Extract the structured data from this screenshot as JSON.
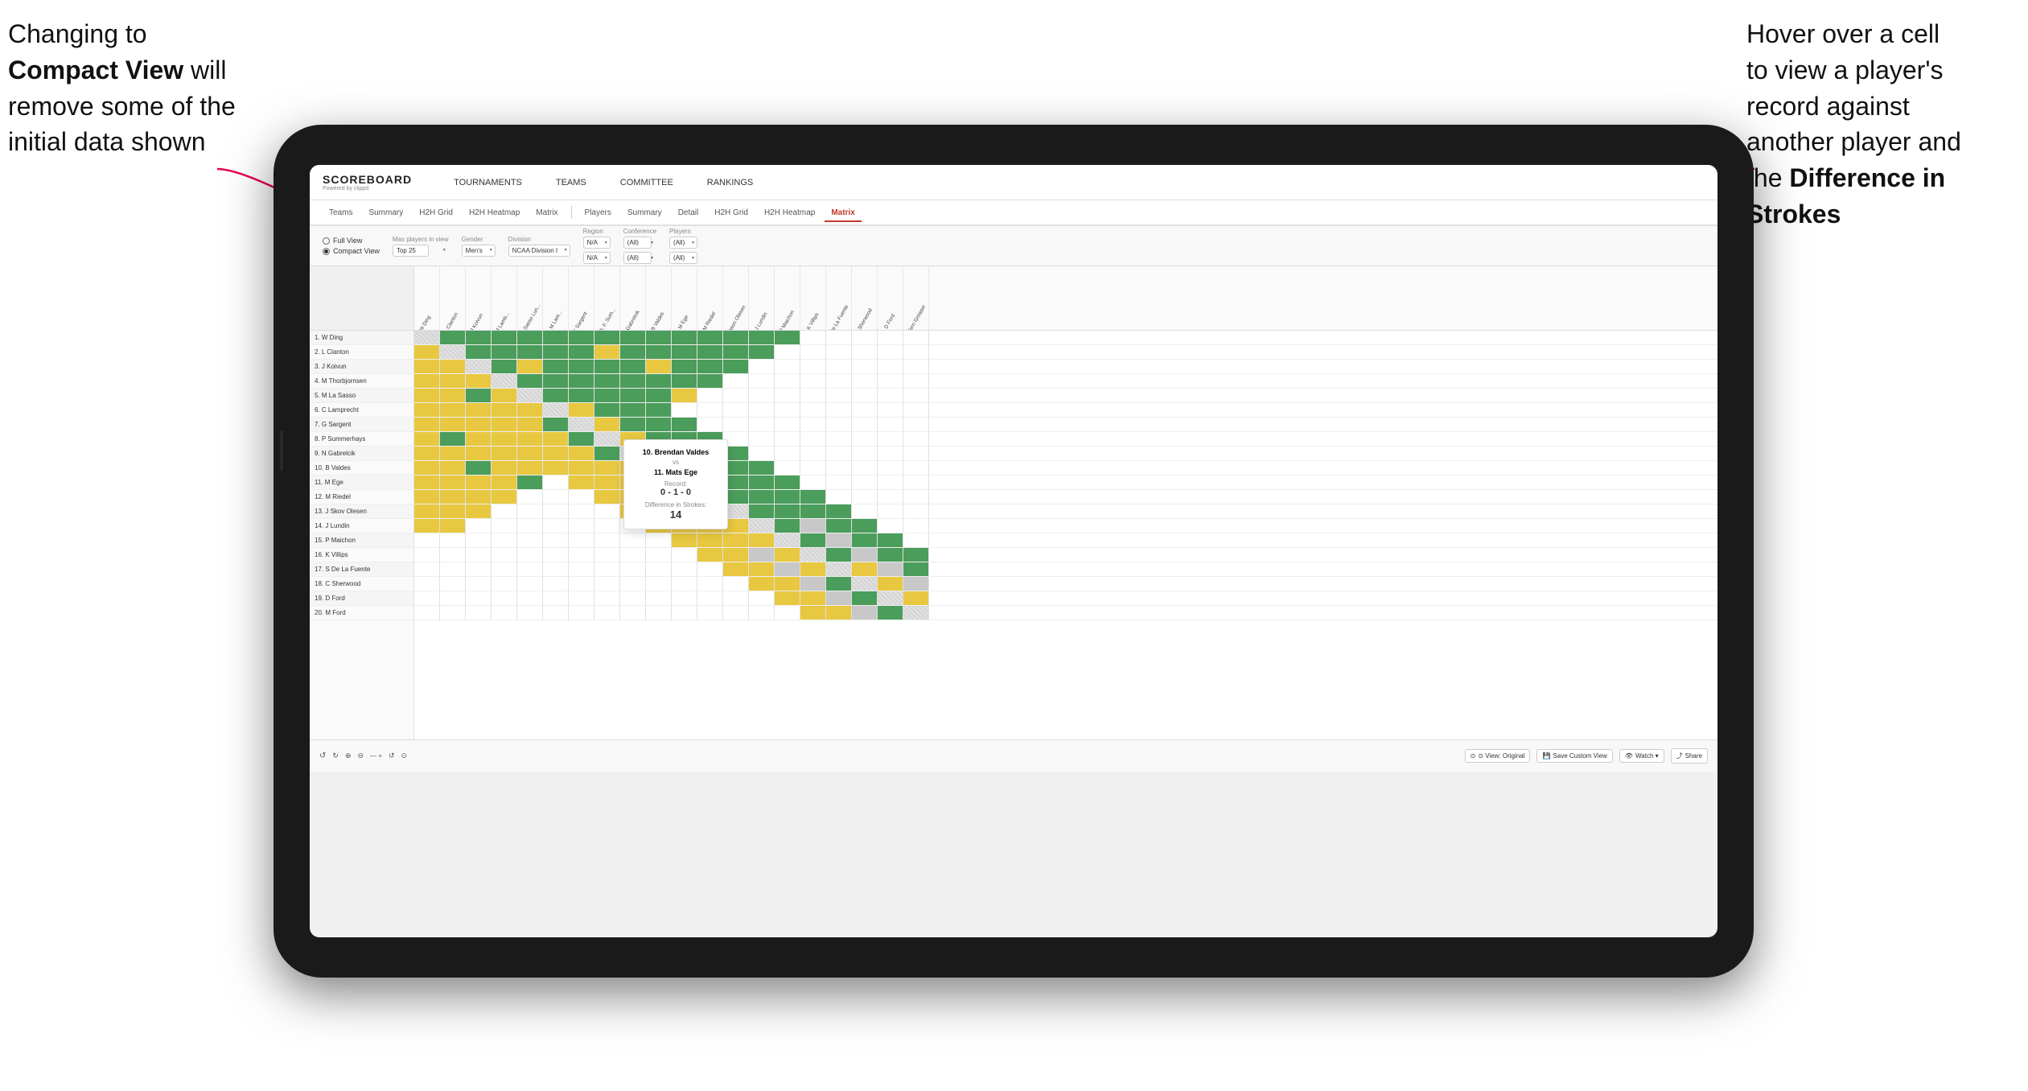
{
  "annotations": {
    "left": {
      "line1": "Changing to",
      "line2": "Compact View will",
      "line3": "remove some of the",
      "line4": "initial data shown"
    },
    "right": {
      "line1": "Hover over a cell",
      "line2": "to view a player's",
      "line3": "record against",
      "line4": "another player and",
      "line5": "the ",
      "bold5": "Difference in",
      "line6": "Strokes"
    }
  },
  "app": {
    "logo": "SCOREBOARD",
    "logo_sub": "Powered by clippd",
    "nav_items": [
      "TOURNAMENTS",
      "TEAMS",
      "COMMITTEE",
      "RANKINGS"
    ],
    "sub_nav_items": [
      "Teams",
      "Summary",
      "H2H Grid",
      "H2H Heatmap",
      "Matrix"
    ],
    "sub_nav_items2": [
      "Players",
      "Summary",
      "Detail",
      "H2H Grid",
      "H2H Heatmap",
      "Matrix"
    ],
    "active_sub": "Matrix"
  },
  "filters": {
    "view_options": [
      "Full View",
      "Compact View"
    ],
    "selected_view": "Compact View",
    "max_players_label": "Max players in view",
    "max_players_value": "Top 25",
    "gender_label": "Gender",
    "gender_value": "Men's",
    "division_label": "Division",
    "division_value": "NCAA Division I",
    "region_label": "Region",
    "region_value": "N/A",
    "conference_label": "Conference",
    "conference_value": "(All)",
    "players_label": "Players",
    "players_value": "(All)"
  },
  "players": [
    "1. W Ding",
    "2. L Clanton",
    "3. J Koivun",
    "4. M Thorbjornsen",
    "5. M La Sasso",
    "6. C Lamprecht",
    "7. G Sargent",
    "8. P Summerhays",
    "9. N Gabrelcik",
    "10. B Valdes",
    "11. M Ege",
    "12. M Riedel",
    "13. J Skov Olesen",
    "14. J Lundin",
    "15. P Maichon",
    "16. K Villips",
    "17. S De La Fuente",
    "18. C Sherwood",
    "19. D Ford",
    "20. M Ford"
  ],
  "col_headers": [
    "1. W Ding",
    "2. L Clanton",
    "3. J Koivun",
    "4. M Lamb...",
    "5. M La Sasso Lun...",
    "6. C. M",
    "7. G Sargent",
    "8. P. B. F.",
    "9. N Gabrelcik",
    "10. B Valdes",
    "11. M Ege",
    "12. M Riedel",
    "13. J Jason Olesen",
    "14. J Lundin",
    "15. P Maichon",
    "16. K Villips",
    "17. S De La Fuente Sherwood",
    "18. C Sherwood",
    "19. D Ford",
    "20. M Fern Greaser"
  ],
  "tooltip": {
    "player1": "10. Brendan Valdes",
    "vs": "vs",
    "player2": "11. Mats Ege",
    "record_label": "Record:",
    "record": "0 - 1 - 0",
    "diff_label": "Difference in Strokes:",
    "diff": "14"
  },
  "toolbar": {
    "undo": "↺",
    "redo": "↻",
    "view_original": "⊙ View: Original",
    "save_custom": "💾 Save Custom View",
    "watch": "👁 Watch ▾",
    "share": "⤴ Share"
  },
  "grid_colors": {
    "green": "#4a9d5b",
    "yellow": "#e8c840",
    "gray": "#c8c8c8",
    "white": "#ffffff",
    "diagonal": "#d0d0d0"
  }
}
